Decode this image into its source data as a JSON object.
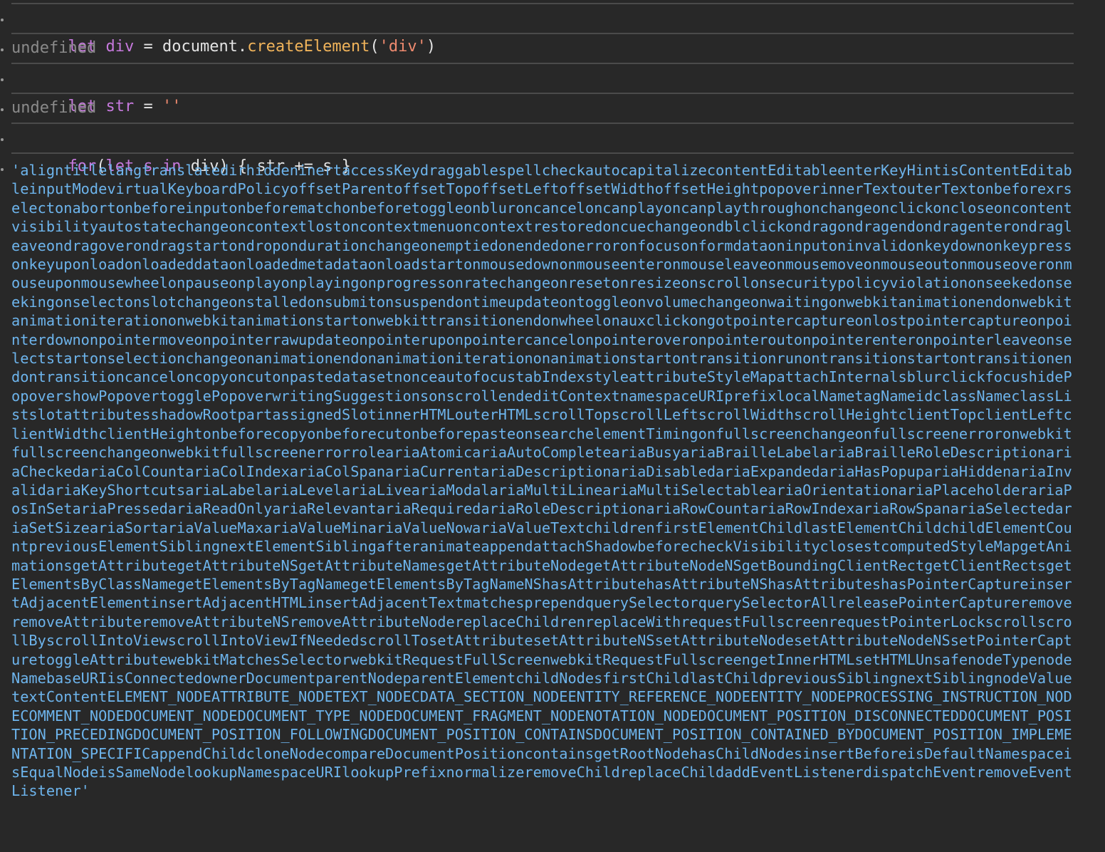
{
  "entries": [
    {
      "type": "input",
      "tokens": [
        {
          "text": "let",
          "kind": "kw"
        },
        {
          "text": " ",
          "kind": "plain"
        },
        {
          "text": "div",
          "kind": "var"
        },
        {
          "text": " = document.",
          "kind": "plain"
        },
        {
          "text": "createElement",
          "kind": "fn"
        },
        {
          "text": "(",
          "kind": "plain"
        },
        {
          "text": "'div'",
          "kind": "str"
        },
        {
          "text": ")",
          "kind": "plain"
        }
      ]
    },
    {
      "type": "output",
      "text": "undefined"
    },
    {
      "type": "input",
      "tokens": [
        {
          "text": "let",
          "kind": "kw"
        },
        {
          "text": " ",
          "kind": "plain"
        },
        {
          "text": "str",
          "kind": "var"
        },
        {
          "text": " = ",
          "kind": "plain"
        },
        {
          "text": "''",
          "kind": "str"
        }
      ]
    },
    {
      "type": "output",
      "text": "undefined"
    },
    {
      "type": "input",
      "tokens": [
        {
          "text": "for",
          "kind": "kw"
        },
        {
          "text": "(",
          "kind": "plain"
        },
        {
          "text": "let",
          "kind": "kw"
        },
        {
          "text": " ",
          "kind": "plain"
        },
        {
          "text": "s",
          "kind": "var"
        },
        {
          "text": " ",
          "kind": "plain"
        },
        {
          "text": "in",
          "kind": "kw"
        },
        {
          "text": " div) { str += s }",
          "kind": "plain"
        }
      ]
    }
  ],
  "result_string": "'aligntitlelangtranslatedirhiddeninertaccessKeydraggablespellcheckautocapitalizecontentEditableenterKeyHintisContentEditableinputModevirtualKeyboardPolicyoffsetParentoffsetTopoffsetLeftoffsetWidthoffsetHeightpopoverinnerTextouterTextonbeforexrselectonabortonbeforeinputonbeforematchonbeforetoggleonbluroncanceloncanplayoncanplaythroughonchangeonclickoncloseoncontentvisibilityautostatechangeoncontextlostoncontextmenuoncontextrestoredoncuechangeondblclickondragondragendondragenterondragleaveondragoverondragstartondropondurationchangeonemptiedonendedonerroronfocusonformdataoninputoninvalidonkeydownonkeypressonkeyuponloadonloadeddataonloadedmetadataonloadstartonmousedownonmouseenteronmouseleaveonmousemoveonmouseoutonmouseoveronmouseuponmousewheelonpauseonplayonplayingonprogressonratechangeonresetonresizeonscrollonsecuritypolicyviolationonseekedonseekingonselectonslotchangeonstalledonsubmitonsuspendontimeupdateontoggleonvolumechangeonwaitingonwebkitanimationendonwebkitanimationiterationonwebkitanimationstartonwebkittransitionendonwheelonauxclickongotpointercaptureonlostpointercaptureonpointerdownonpointermoveonpointerrawupdateonpointeruponpointercancelonpointeroveronpointeroutonpointerenteronpointerleaveonselectstartonselectionchangeonanimationendonanimationiterationonanimationstartontransitionrunontransitionstartontransitionendontransitioncanceloncopyoncutonpastedatasetnonceautofocustabIndexstyleattributeStyleMapattachInternalsblurclickfocushidePopovershowPopovertogglePopoverwritingSuggestionsonscrollendeditContextnamespaceURIprefixlocalNametagNameidclassNameclassListslotattributesshadowRootpartassignedSlotinnerHTMLouterHTMLscrollTopscrollLeftscrollWidthscrollHeightclientTopclientLeftclientWidthclientHeightonbeforecopyonbeforecutonbeforepasteonsearchelementTimingonfullscreenchangeonfullscreenerroronwebkitfullscreenchangeonwebkitfullscreenerrorroleariaAtomicariaAutoCompleteariaBusyariaBrailleLabelariaBrailleRoleDescriptionariaCheckedariaColCountariaColIndexariaColSpanariaCurrentariaDescriptionariaDisabledariaExpandedariaHasPopupariaHiddenariaInvalidariaKeyShortcutsariaLabelariaLevelariaLiveariaModalariaMultiLineariaMultiSelectableariaOrientationariaPlaceholderariaPosInSetariaPressedariaReadOnlyariaRelevantariaRequiredariaRoleDescriptionariaRowCountariaRowIndexariaRowSpanariaSelectedariaSetSizeariaSortariaValueMaxariaValueMinariaValueNowariaValueTextchildrenfirstElementChildlastElementChildchildElementCountpreviousElementSiblingnextElementSiblingafteranimateappendattachShadowbeforecheckVisibilityclosestcomputedStyleMapgetAnimationsgetAttributegetAttributeNSgetAttributeNamesgetAttributeNodegetAttributeNodeNSgetBoundingClientRectgetClientRectsgetElementsByClassNamegetElementsByTagNamegetElementsByTagNameNShasAttributehasAttributeNShasAttributeshasPointerCaptureinsertAdjacentElementinsertAdjacentHTMLinsertAdjacentTextmatchesprependquerySelectorquerySelectorAllreleasePointerCaptureremoveremoveAttributeremoveAttributeNSremoveAttributeNodereplaceChildrenreplaceWithrequestFullscreenrequestPointerLockscrollscrollByscrollIntoViewscrollIntoViewIfNeededscrollTosetAttributesetAttributeNSsetAttributeNodesetAttributeNodeNSsetPointerCapturetoggleAttributewebkitMatchesSelectorwebkitRequestFullScreenwebkitRequestFullscreengetInnerHTMLsetHTMLUnsafenodeTypenodeNamebaseURIisConnectedownerDocumentparentNodeparentElementchildNodesfirstChildlastChildpreviousSiblingnextSiblingnodeValuetextContentELEMENT_NODEATTRIBUTE_NODETEXT_NODECDATA_SECTION_NODEENTITY_REFERENCE_NODEENTITY_NODEPROCESSING_INSTRUCTION_NODECOMMENT_NODEDOCUMENT_NODEDOCUMENT_TYPE_NODEDOCUMENT_FRAGMENT_NODENOTATION_NODEDOCUMENT_POSITION_DISCONNECTEDDOCUMENT_POSITION_PRECEDINGDOCUMENT_POSITION_FOLLOWINGDOCUMENT_POSITION_CONTAINSDOCUMENT_POSITION_CONTAINED_BYDOCUMENT_POSITION_IMPLEMENTATION_SPECIFICappendChildcloneNodecompareDocumentPositioncontainsgetRootNodehasChildNodesinsertBeforeisDefaultNamespaceisEqualNodeisSameNodelookupNamespaceURIlookupPrefixnormalizeremoveChildreplaceChildaddEventListenerdispatchEventremoveEventListener'",
  "colors": {
    "background": "#282828",
    "divider": "#4b4b4b",
    "keyword": "#c679dd",
    "function": "#f0b35a",
    "string": "#ee8a6f",
    "undefined": "#8a8a8a",
    "result": "#6db4ec"
  }
}
